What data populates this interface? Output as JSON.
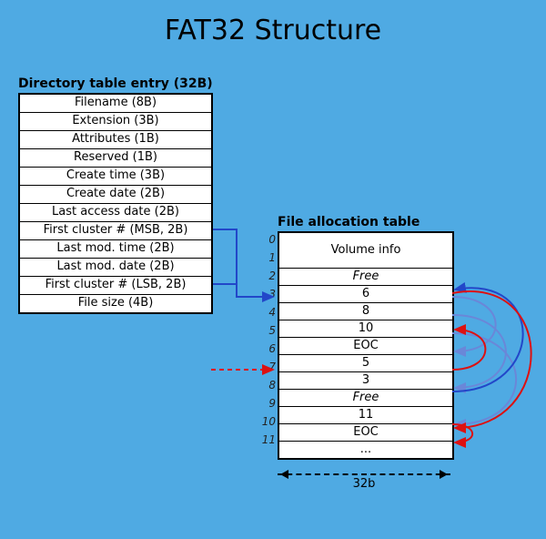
{
  "title": "FAT32 Structure",
  "directory": {
    "heading": "Directory table entry (32B)",
    "fields": [
      "Filename (8B)",
      "Extension (3B)",
      "Attributes (1B)",
      "Reserved (1B)",
      "Create time (3B)",
      "Create date (2B)",
      "Last access date (2B)",
      "First cluster # (MSB, 2B)",
      "Last mod. time (2B)",
      "Last mod. date (2B)",
      "First cluster # (LSB, 2B)",
      "File size (4B)"
    ]
  },
  "fat": {
    "heading": "File allocation table",
    "width_label": "32b",
    "rows": [
      {
        "idx": "0",
        "label": "Volume info",
        "tall": true
      },
      {
        "idx": "1",
        "label": "",
        "hidden": true
      },
      {
        "idx": "2",
        "label": "Free",
        "free": true
      },
      {
        "idx": "3",
        "label": "6"
      },
      {
        "idx": "4",
        "label": "8"
      },
      {
        "idx": "5",
        "label": "10"
      },
      {
        "idx": "6",
        "label": "EOC"
      },
      {
        "idx": "7",
        "label": "5"
      },
      {
        "idx": "8",
        "label": "3"
      },
      {
        "idx": "9",
        "label": "Free",
        "free": true
      },
      {
        "idx": "10",
        "label": "11"
      },
      {
        "idx": "11",
        "label": "EOC"
      },
      {
        "idx": "",
        "label": "..."
      }
    ]
  },
  "chart_data": {
    "type": "table",
    "title": "FAT32 Structure",
    "directory_entry_size_bytes": 32,
    "directory_entry_fields": [
      {
        "name": "Filename",
        "bytes": 8
      },
      {
        "name": "Extension",
        "bytes": 3
      },
      {
        "name": "Attributes",
        "bytes": 1
      },
      {
        "name": "Reserved",
        "bytes": 1
      },
      {
        "name": "Create time",
        "bytes": 3
      },
      {
        "name": "Create date",
        "bytes": 2
      },
      {
        "name": "Last access date",
        "bytes": 2
      },
      {
        "name": "First cluster # (MSB)",
        "bytes": 2
      },
      {
        "name": "Last mod. time",
        "bytes": 2
      },
      {
        "name": "Last mod. date",
        "bytes": 2
      },
      {
        "name": "First cluster # (LSB)",
        "bytes": 2
      },
      {
        "name": "File size",
        "bytes": 4
      }
    ],
    "fat_entry_width_bits": 32,
    "fat_entries": [
      {
        "index": 0,
        "value": "Volume info"
      },
      {
        "index": 1,
        "value": "Volume info"
      },
      {
        "index": 2,
        "value": "Free"
      },
      {
        "index": 3,
        "value": 6
      },
      {
        "index": 4,
        "value": 8
      },
      {
        "index": 5,
        "value": 10
      },
      {
        "index": 6,
        "value": "EOC"
      },
      {
        "index": 7,
        "value": 5
      },
      {
        "index": 8,
        "value": 3
      },
      {
        "index": 9,
        "value": "Free"
      },
      {
        "index": 10,
        "value": 11
      },
      {
        "index": 11,
        "value": "EOC"
      }
    ],
    "cluster_chain_blue": [
      3,
      6,
      4,
      8,
      5,
      10
    ],
    "cluster_chain_red": [
      7,
      5,
      8,
      3,
      10,
      11
    ],
    "directory_first_cluster_msb_points_to": 3,
    "directory_first_cluster_lsb_points_to": 3
  }
}
